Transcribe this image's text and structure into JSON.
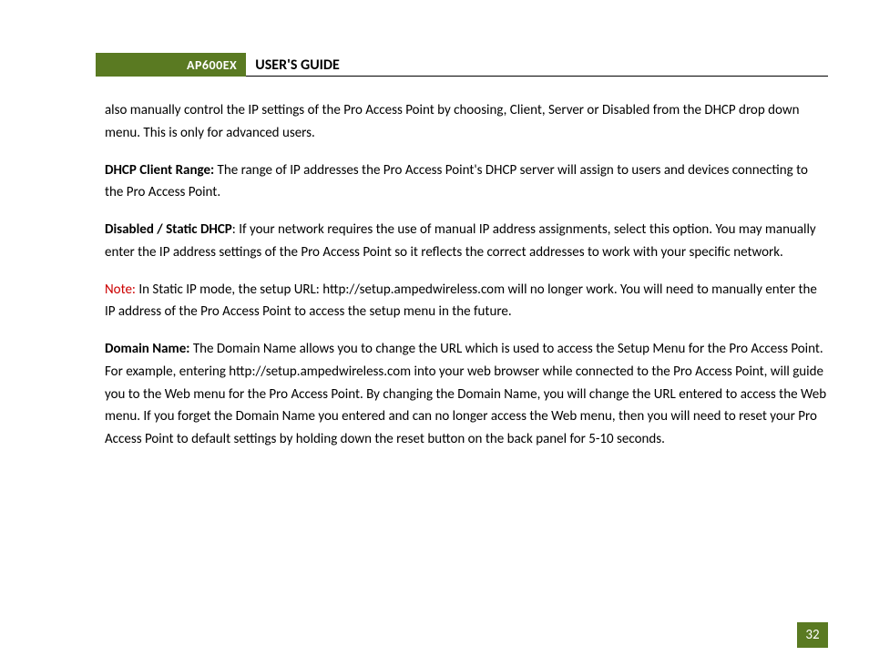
{
  "header": {
    "product": "AP600EX",
    "title": "USER'S GUIDE"
  },
  "paragraphs": {
    "p1": "also manually control the IP settings of the Pro Access Point by choosing, Client, Server or Disabled from the DHCP drop down menu.  This is only for advanced users.",
    "p2_label": "DHCP Client Range:",
    "p2_text": " The range of IP addresses the Pro Access Point's DHCP server will assign to users and devices connecting to the Pro Access Point.",
    "p3_label": "Disabled / Static DHCP",
    "p3_text": ": If your network requires the use of manual IP address assignments, select this option. You may manually enter the IP address settings of the Pro Access Point so it reflects the correct addresses to work with your specific network.",
    "p4_note": "Note:",
    "p4_text": "  In Static IP mode, the setup URL: http://setup.ampedwireless.com will no longer work.  You will need to manually enter the IP address of the Pro Access Point to access the setup menu in the future.",
    "p5_label": "Domain Name:",
    "p5_text": " The Domain Name allows you to change the URL which is used to access the Setup Menu for the Pro Access Point.  For example, entering http://setup.ampedwireless.com into your web browser while connected to the Pro Access Point, will guide you to the Web menu for the Pro Access Point.  By changing the Domain Name, you will change the URL entered to access the Web menu.  If you forget the Domain Name you entered and can no longer access the Web menu, then you will need to reset your Pro Access Point to default settings by holding down the reset button on the back panel for 5-10 seconds."
  },
  "page_number": "32"
}
